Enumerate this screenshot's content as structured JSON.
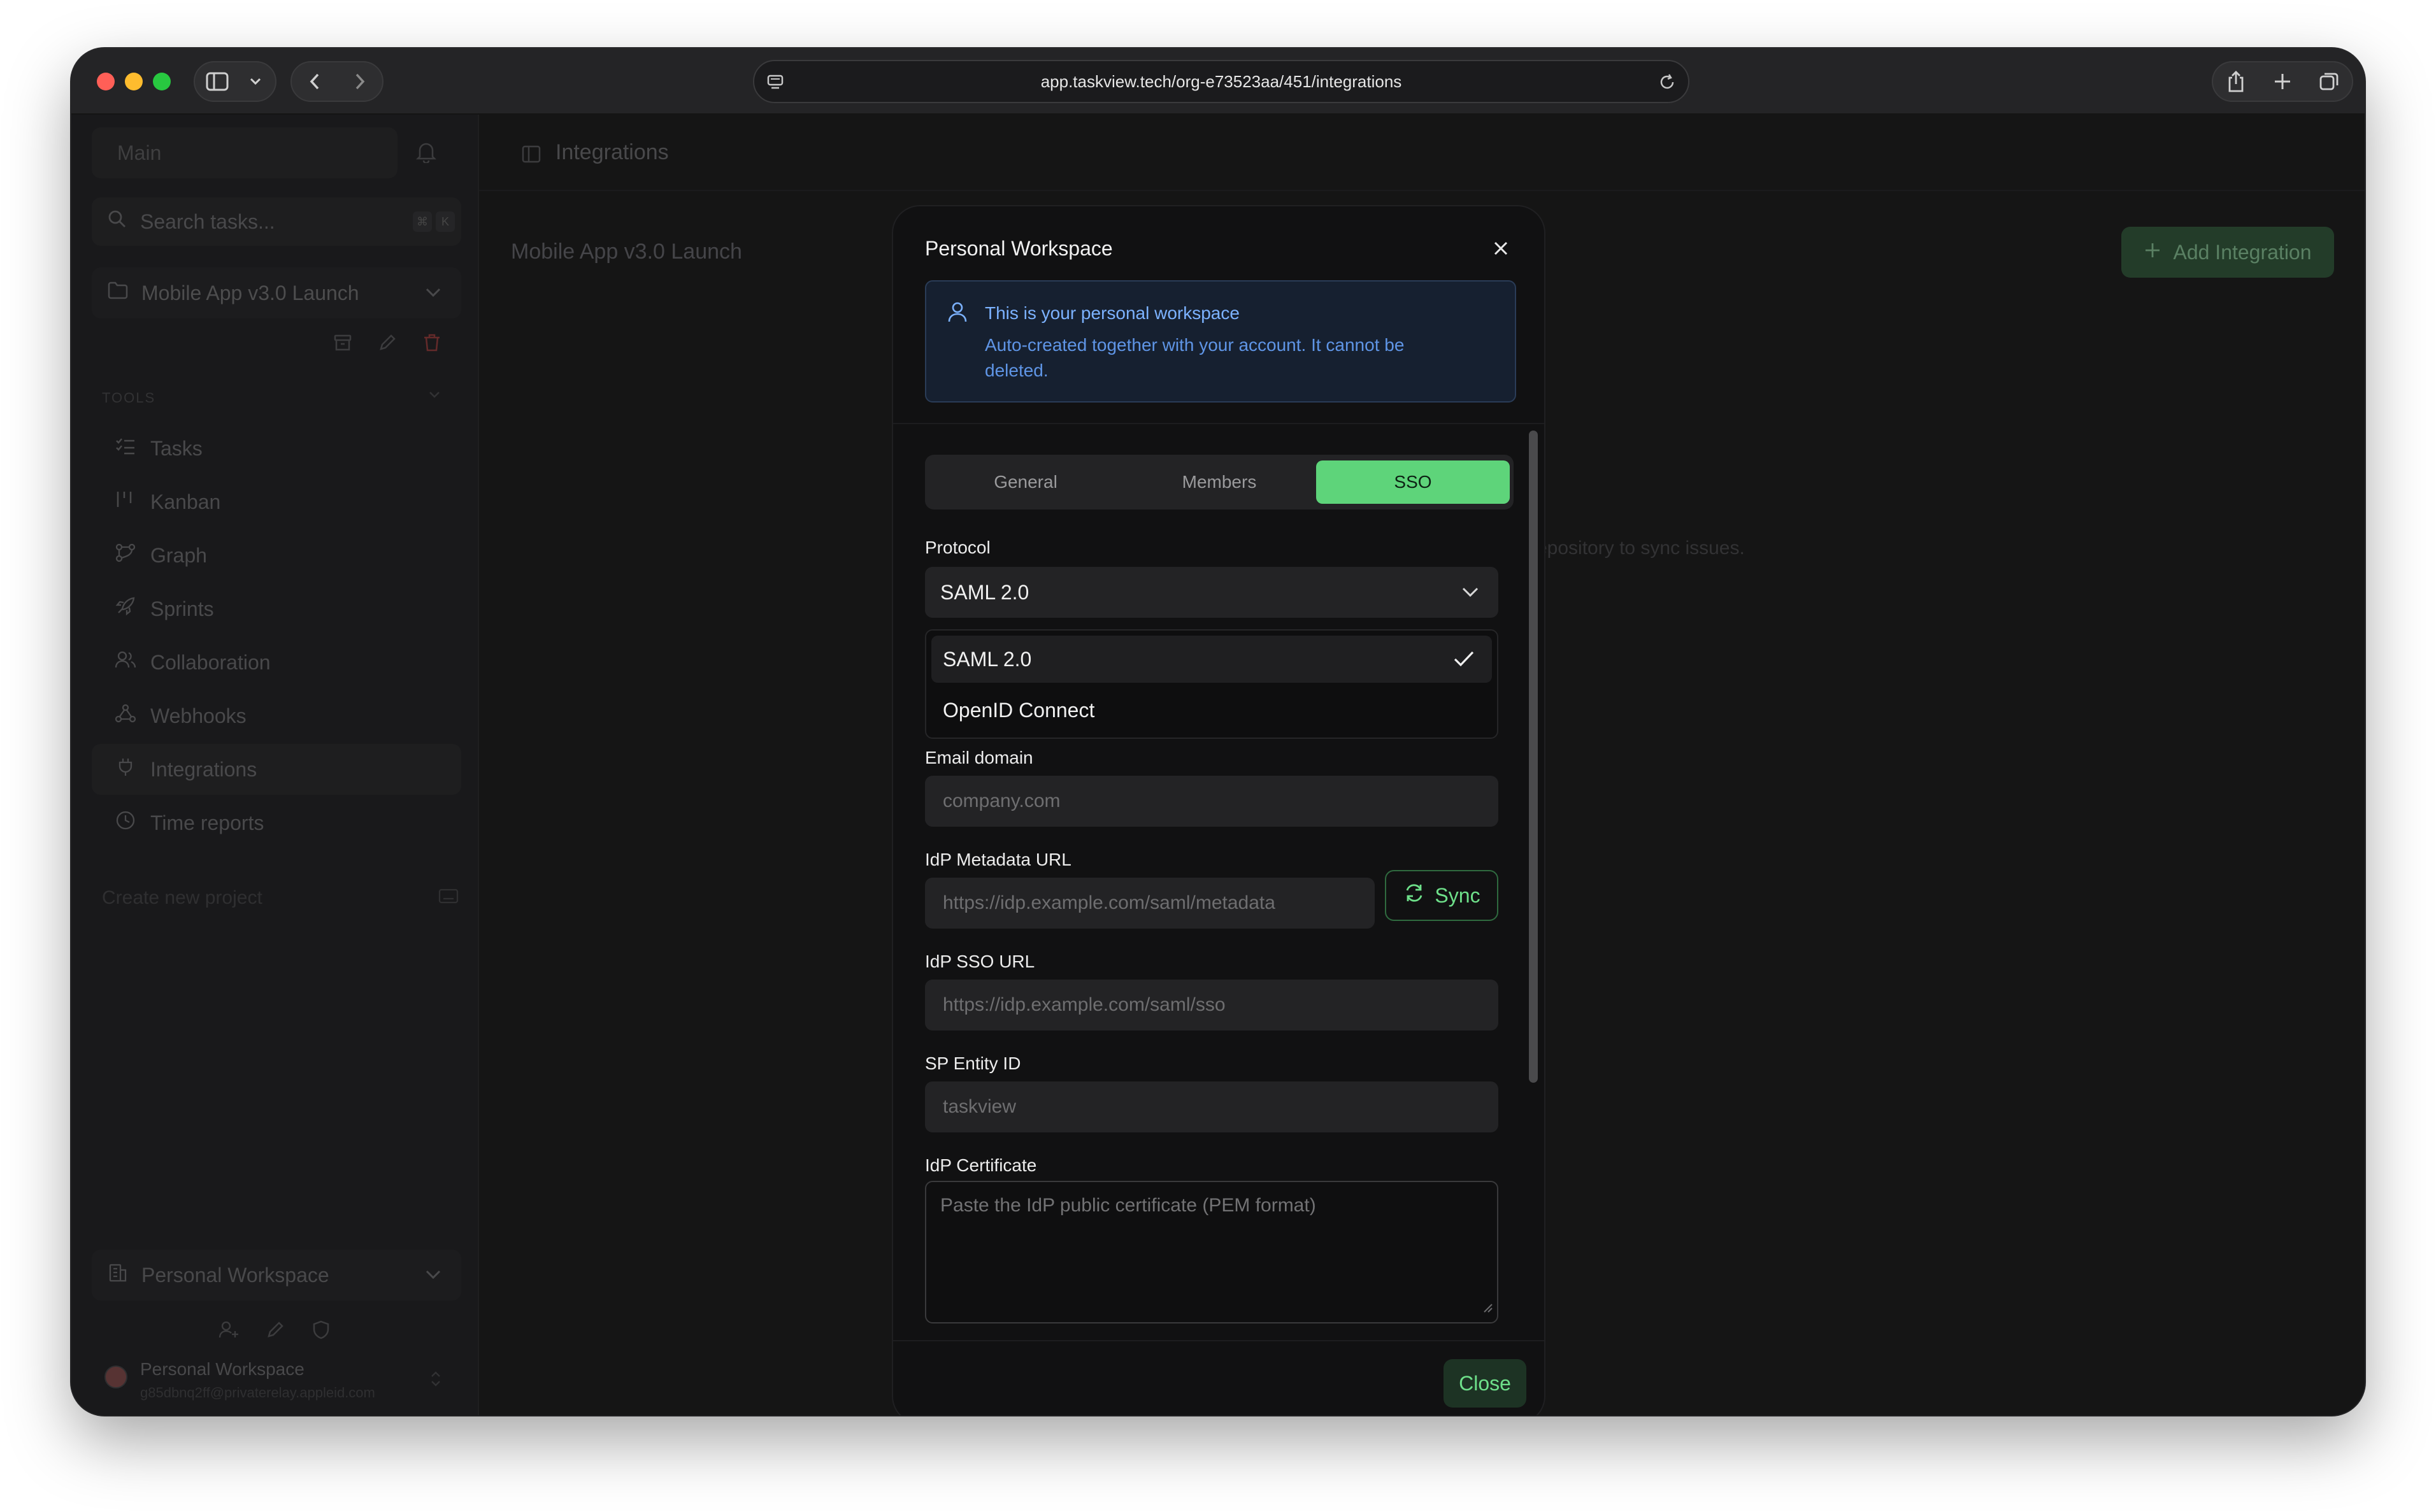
{
  "browser": {
    "url": "app.taskview.tech/org-e73523aa/451/integrations"
  },
  "sidebar": {
    "main_label": "Main",
    "search_placeholder": "Search tasks...",
    "shortcut_keys": [
      "⌘",
      "K"
    ],
    "project_selector": "Mobile App v3.0 Launch",
    "tools_label": "TOOLS",
    "nav_items": [
      {
        "label": "Tasks",
        "icon": "list-check-icon"
      },
      {
        "label": "Kanban",
        "icon": "kanban-icon"
      },
      {
        "label": "Graph",
        "icon": "graph-icon"
      },
      {
        "label": "Sprints",
        "icon": "rocket-icon"
      },
      {
        "label": "Collaboration",
        "icon": "users-icon"
      },
      {
        "label": "Webhooks",
        "icon": "webhook-icon"
      },
      {
        "label": "Integrations",
        "icon": "plug-icon",
        "active": true
      },
      {
        "label": "Time reports",
        "icon": "clock-icon"
      }
    ],
    "create_project": "Create new project",
    "workspace_selector": "Personal Workspace",
    "user": {
      "name": "Personal Workspace",
      "email": "g85dbnq2ff@privaterelay.appleid.com"
    }
  },
  "page": {
    "header_title": "Integrations",
    "project_title": "Mobile App v3.0 Launch",
    "add_integration_label": "Add Integration",
    "empty_hint_partial": "epository to sync issues."
  },
  "modal": {
    "title": "Personal Workspace",
    "info": {
      "heading": "This is your personal workspace",
      "body": "Auto-created together with your account. It cannot be deleted."
    },
    "tabs": [
      {
        "label": "General",
        "active": false
      },
      {
        "label": "Members",
        "active": false
      },
      {
        "label": "SSO",
        "active": true
      }
    ],
    "protocol": {
      "label": "Protocol",
      "selected": "SAML 2.0",
      "options": [
        "SAML 2.0",
        "OpenID Connect"
      ]
    },
    "email_domain": {
      "label": "Email domain",
      "placeholder": "company.com"
    },
    "idp_metadata_url": {
      "label": "IdP Metadata URL",
      "placeholder": "https://idp.example.com/saml/metadata",
      "sync_label": "Sync"
    },
    "idp_sso_url": {
      "label": "IdP SSO URL",
      "placeholder": "https://idp.example.com/saml/sso"
    },
    "sp_entity_id": {
      "label": "SP Entity ID",
      "placeholder": "taskview"
    },
    "idp_certificate": {
      "label": "IdP Certificate",
      "placeholder": "Paste the IdP public certificate (PEM format)"
    },
    "close_label": "Close"
  },
  "colors": {
    "accent_green": "#5ed47a",
    "info_blue": "#7cb2ff",
    "danger_red": "#b23b3b"
  }
}
